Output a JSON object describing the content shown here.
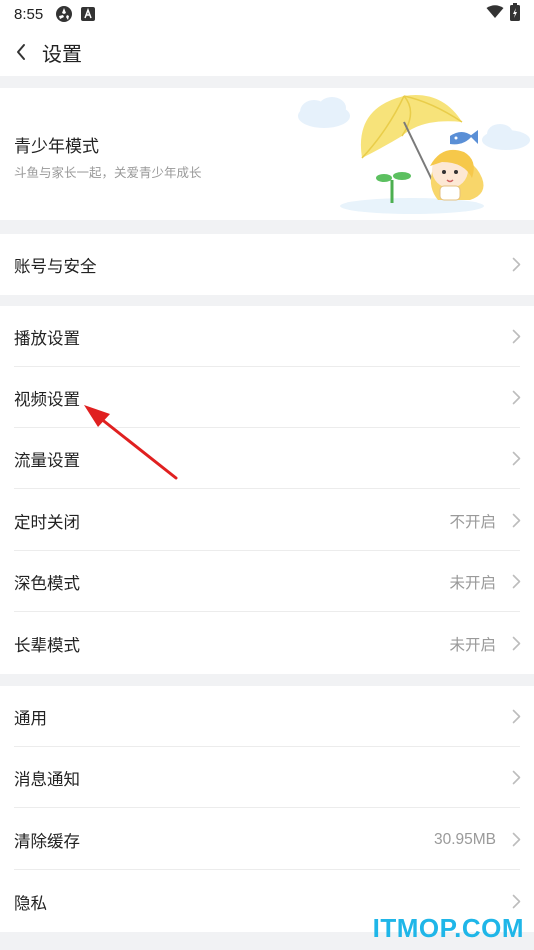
{
  "status_bar": {
    "time": "8:55"
  },
  "nav": {
    "title": "设置"
  },
  "youth": {
    "title": "青少年模式",
    "subtitle": "斗鱼与家长一起，关爱青少年成长"
  },
  "account": {
    "label": "账号与安全"
  },
  "group1": [
    {
      "label": "播放设置",
      "value": ""
    },
    {
      "label": "视频设置",
      "value": ""
    },
    {
      "label": "流量设置",
      "value": ""
    },
    {
      "label": "定时关闭",
      "value": "不开启"
    },
    {
      "label": "深色模式",
      "value": "未开启"
    },
    {
      "label": "长辈模式",
      "value": "未开启"
    }
  ],
  "group2": [
    {
      "label": "通用",
      "value": ""
    },
    {
      "label": "消息通知",
      "value": ""
    },
    {
      "label": "清除缓存",
      "value": "30.95MB"
    },
    {
      "label": "隐私",
      "value": ""
    }
  ],
  "watermark": "ITMOP.COM",
  "colors": {
    "annotation_arrow": "#e02020",
    "watermark": "#1fb6e8",
    "umbrella": "#f7e37a"
  }
}
